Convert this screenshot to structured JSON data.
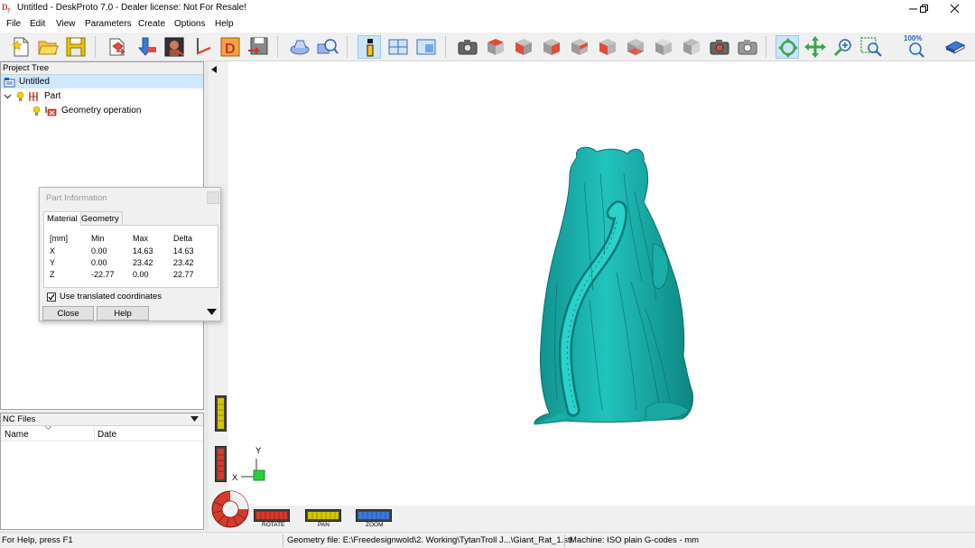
{
  "window": {
    "title": "Untitled - DeskProto 7.0 - Dealer license: Not For Resale!"
  },
  "menu": [
    "File",
    "Edit",
    "View",
    "Parameters",
    "Create",
    "Options",
    "Help"
  ],
  "toolbar": {
    "zoom_label": "100%"
  },
  "project_tree": {
    "header": "Project Tree",
    "root": "Untitled",
    "part": "Part",
    "geometry_operation": "Geometry operation"
  },
  "nc_files": {
    "header": "NC Files",
    "col_name": "Name",
    "col_date": "Date"
  },
  "part_info": {
    "title": "Part Information",
    "tabs": [
      "Material",
      "Geometry"
    ],
    "headers": [
      "[mm]",
      "Min",
      "Max",
      "Delta"
    ],
    "rows": [
      [
        "X",
        "0.00",
        "14.63",
        "14.63"
      ],
      [
        "Y",
        "0.00",
        "23.42",
        "23.42"
      ],
      [
        "Z",
        "-22.77",
        "0.00",
        "22.77"
      ]
    ],
    "checkbox_label": "Use translated coordinates",
    "checkbox_checked": true,
    "close_button": "Close",
    "help_button": "Help"
  },
  "viewport": {
    "axis_y": "Y",
    "axis_x": "X",
    "mode_rotate": "ROTATE",
    "mode_pan": "PAN",
    "mode_zoom": "ZOOM",
    "model_color": "#1fb5b0"
  },
  "status": {
    "help": "For Help, press F1",
    "geometry_file": "Geometry file: E:\\Freedesignwold\\2. Working\\TytanTroll J...\\Giant_Rat_1.stl",
    "machine": "Machine: ISO plain G-codes - mm"
  }
}
